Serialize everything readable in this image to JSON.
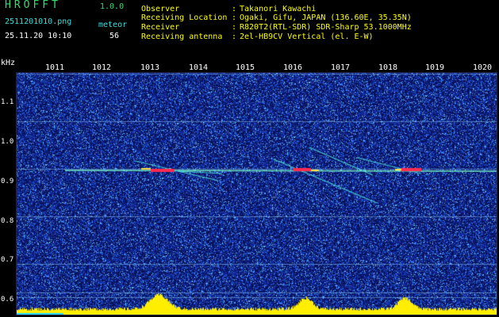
{
  "header": {
    "app_title": "HROFFT",
    "app_version": "1.0.0",
    "file_name": "2511201010.png",
    "timestamp": "25.11.20 10:10",
    "detection_type": "meteor",
    "detection_count": "56"
  },
  "info": [
    {
      "label": "Observer",
      "colon": ":",
      "value": "Takanori Kawachi"
    },
    {
      "label": "Receiving Location",
      "colon": ":",
      "value": "Ogaki, Gifu, JAPAN (136.60E, 35.35N)"
    },
    {
      "label": "Receiver",
      "colon": ":",
      "value": "R820T2(RTL-SDR) SDR-Sharp 53.1000MHz"
    },
    {
      "label": "Receiving antenna",
      "colon": ":",
      "value": "2el-HB9CV Vertical (el. E-W)"
    }
  ],
  "axes": {
    "y_unit": "kHz",
    "y_ticks": [
      "1.1",
      "1.0",
      "0.9",
      "0.8",
      "0.7",
      "0.6"
    ],
    "x_ticks": [
      "1011",
      "1012",
      "1013",
      "1014",
      "1015",
      "1016",
      "1017",
      "1018",
      "1019",
      "1020"
    ]
  },
  "colors": {
    "background": "#000000",
    "spectrogram_noise": "#1a2fa8",
    "signal_trace": "#00ffd0",
    "meteor_hot": "#ff2040",
    "power_meter": "#ffee00",
    "header_green": "#2ee06e",
    "header_cyan": "#37e0e0"
  }
}
